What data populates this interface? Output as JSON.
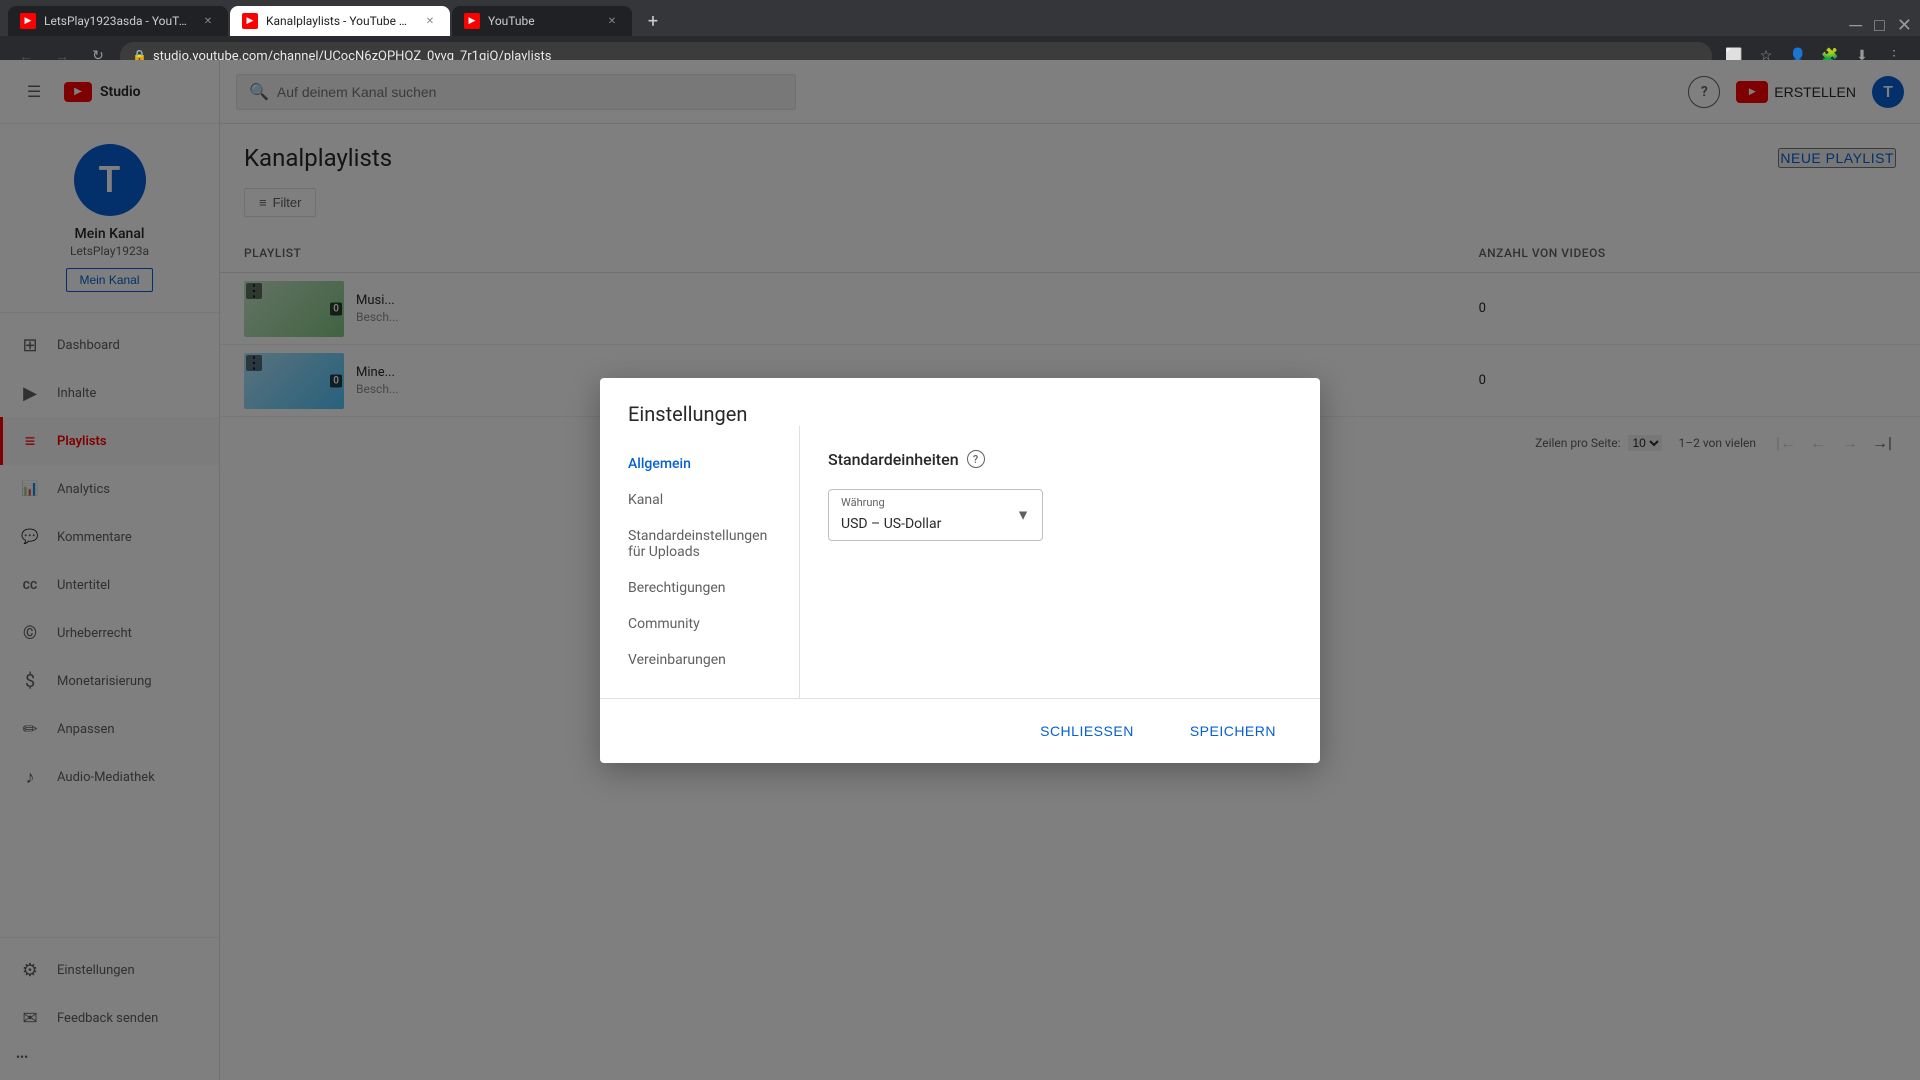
{
  "browser": {
    "tabs": [
      {
        "id": "tab1",
        "title": "LetsPlay1923asda - YouTube...",
        "favicon_color": "#ff0000",
        "active": false
      },
      {
        "id": "tab2",
        "title": "Kanalplaylists - YouTube S...",
        "favicon_color": "#ff0000",
        "active": true
      },
      {
        "id": "tab3",
        "title": "YouTube",
        "favicon_color": "#ff0000",
        "active": false
      }
    ],
    "new_tab_label": "+",
    "address": "studio.youtube.com/channel/UCocN6zQPHQZ_0yvq_7r1qiQ/playlists",
    "nav": {
      "back_disabled": false,
      "forward_disabled": true,
      "reload": "↻",
      "back": "←",
      "forward": "→"
    }
  },
  "app": {
    "topbar": {
      "hamburger_icon": "☰",
      "logo_text": "Studio",
      "search_placeholder": "Auf deinem Kanal suchen",
      "help_label": "?",
      "create_label": "ERSTELLEN",
      "user_initial": "T"
    },
    "sidebar": {
      "channel_name": "Mein Kanal",
      "channel_handle": "LetsPlay1923a",
      "channel_initial": "T",
      "nav_items": [
        {
          "id": "dashboard",
          "label": "Dashboard",
          "icon": "⊞",
          "active": false
        },
        {
          "id": "content",
          "label": "Inhalte",
          "icon": "▶",
          "active": false
        },
        {
          "id": "playlists",
          "label": "Playlists",
          "icon": "≡",
          "active": true
        },
        {
          "id": "analytics",
          "label": "Analytics",
          "icon": "📊",
          "active": false
        },
        {
          "id": "comments",
          "label": "Kommentare",
          "icon": "💬",
          "active": false
        },
        {
          "id": "subtitles",
          "label": "Untertitel",
          "icon": "CC",
          "active": false
        },
        {
          "id": "copyright",
          "label": "Urheberrecht",
          "icon": "©",
          "active": false
        },
        {
          "id": "monetize",
          "label": "Monetarisierung",
          "icon": "$",
          "active": false
        },
        {
          "id": "customize",
          "label": "Anpassen",
          "icon": "✏",
          "active": false
        },
        {
          "id": "audio",
          "label": "Audio-Mediathek",
          "icon": "♪",
          "active": false
        }
      ],
      "bottom_items": [
        {
          "id": "settings",
          "label": "Einstellungen",
          "icon": "⚙"
        },
        {
          "id": "feedback",
          "label": "Feedback senden",
          "icon": "✉"
        }
      ],
      "more_btn": "..."
    },
    "page": {
      "title": "Kanalplaylists",
      "new_playlist_btn": "NEUE PLAYLIST",
      "filter_btn": "Filter",
      "filter_icon": "≡",
      "table": {
        "headers": [
          "Playlist",
          "",
          "",
          "Anzahl von Videos"
        ],
        "rows": [
          {
            "name": "Musi...",
            "desc": "Besch...",
            "thumb_type": "1",
            "visibility": "",
            "date": "",
            "count": "0",
            "badge": "0"
          },
          {
            "name": "Mine...",
            "desc": "Besch...",
            "thumb_type": "2",
            "visibility": "",
            "date": "",
            "count": "0",
            "badge": "0"
          }
        ]
      },
      "pagination": {
        "rows_per_page_label": "Zeilen pro Seite:",
        "rows_per_page_value": "10",
        "info": "1–2 von vielen",
        "first_icon": "|←",
        "prev_icon": "←",
        "next_icon": "→",
        "last_icon": "→|"
      }
    }
  },
  "modal": {
    "title": "Einstellungen",
    "nav_items": [
      {
        "id": "allgemein",
        "label": "Allgemein",
        "active": true
      },
      {
        "id": "kanal",
        "label": "Kanal",
        "active": false
      },
      {
        "id": "uploads",
        "label": "Standardeinstellungen für Uploads",
        "active": false
      },
      {
        "id": "permissions",
        "label": "Berechtigungen",
        "active": false
      },
      {
        "id": "community",
        "label": "Community",
        "active": false
      },
      {
        "id": "agreements",
        "label": "Vereinbarungen",
        "active": false
      }
    ],
    "content": {
      "section_title": "Standardeinheiten",
      "info_icon": "?",
      "currency": {
        "label": "Währung",
        "value": "USD – US-Dollar",
        "arrow": "▼"
      }
    },
    "footer": {
      "close_label": "SCHLIESSEN",
      "save_label": "SPEICHERN"
    }
  }
}
